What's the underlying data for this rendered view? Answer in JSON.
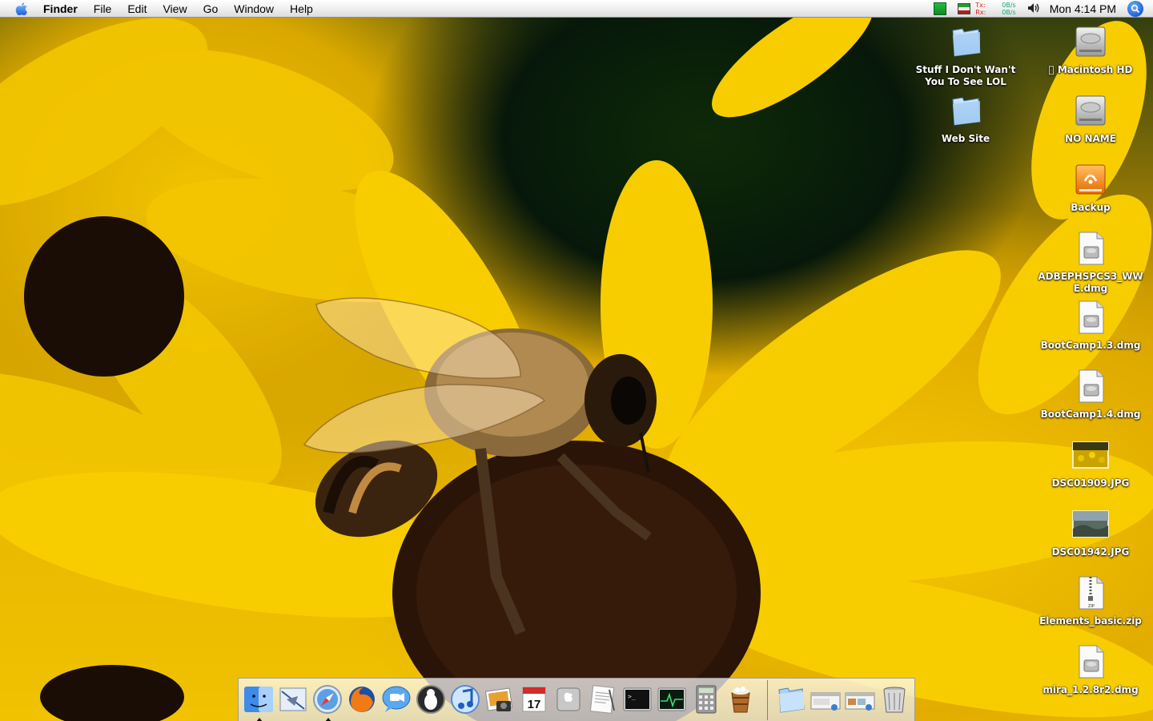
{
  "menubar": {
    "app_name": "Finder",
    "menus": [
      "File",
      "Edit",
      "View",
      "Go",
      "Window",
      "Help"
    ],
    "net_tx_label": "Tx:",
    "net_rx_label": "Rx:",
    "net_tx_value": "0B/s",
    "net_rx_value": "0B/s",
    "clock": "Mon 4:14 PM"
  },
  "desktop": {
    "icons": [
      {
        "label": "Stuff I Don't Wan't You To See LOL",
        "kind": "folder-icon"
      },
      {
        "label": "Macintosh HD",
        "kind": "hard-drive-icon"
      },
      {
        "label": "Web Site",
        "kind": "folder-icon"
      },
      {
        "label": "NO NAME",
        "kind": "hard-drive-icon"
      },
      {
        "label": "Backup",
        "kind": "firewire-drive-icon"
      },
      {
        "label": "ADBEPHSPCS3_WWE.dmg",
        "kind": "disk-image-icon"
      },
      {
        "label": "BootCamp1.3.dmg",
        "kind": "disk-image-icon"
      },
      {
        "label": "BootCamp1.4.dmg",
        "kind": "disk-image-icon"
      },
      {
        "label": "DSC01909.JPG",
        "kind": "photo-thumbnail-icon"
      },
      {
        "label": "DSC01942.JPG",
        "kind": "photo-thumbnail-icon"
      },
      {
        "label": "Elements_basic.zip",
        "kind": "zip-archive-icon"
      },
      {
        "label": "mira_1.2.8r2.dmg",
        "kind": "disk-image-icon"
      }
    ]
  },
  "dock": {
    "apps": [
      "finder-icon",
      "mail-icon",
      "safari-icon",
      "firefox-icon",
      "ichat-icon",
      "adium-icon",
      "itunes-icon",
      "iphoto-icon",
      "ical-icon",
      "system-preferences-icon",
      "textedit-icon",
      "terminal-icon",
      "activity-monitor-icon",
      "calculator-icon",
      "dock-app-icon"
    ],
    "calendar_day": "17",
    "others": [
      "applications-folder-icon",
      "stack-icon-1",
      "stack-icon-2",
      "trash-icon"
    ]
  },
  "colors": {
    "label_text": "#ffffff",
    "menubar_bg": "#eeeeee",
    "spotlight": "#1b5fd6"
  }
}
